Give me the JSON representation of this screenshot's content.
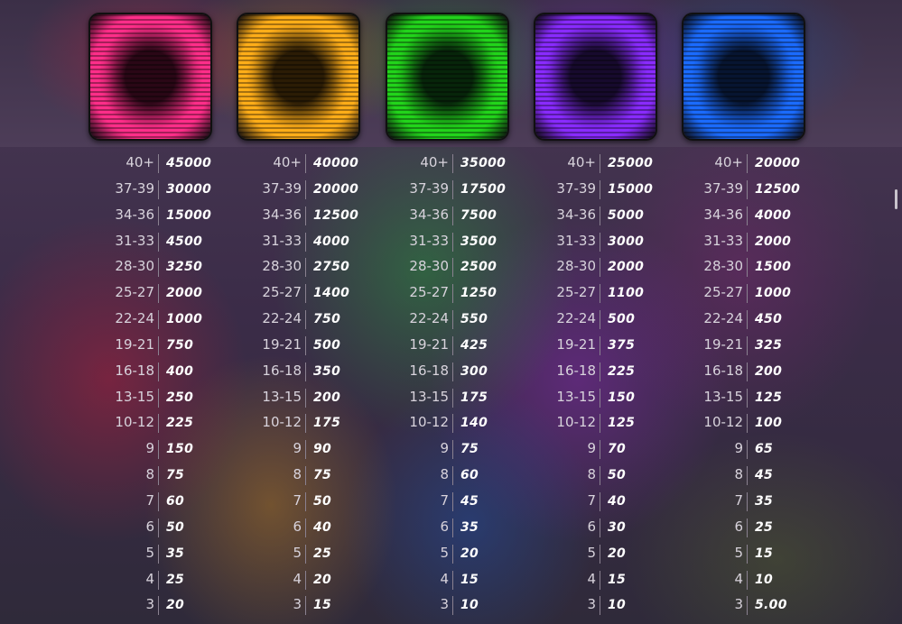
{
  "symbols": [
    {
      "name": "pink",
      "color": "#ff2f8a",
      "core": "#2a0716"
    },
    {
      "name": "orange",
      "color": "#ffae1a",
      "core": "#2b1c05"
    },
    {
      "name": "green",
      "color": "#23d51c",
      "core": "#07250a"
    },
    {
      "name": "purple",
      "color": "#8a2cff",
      "core": "#170a2d"
    },
    {
      "name": "blue",
      "color": "#1c6cff",
      "core": "#071531"
    }
  ],
  "ranges": [
    "40+",
    "37-39",
    "34-36",
    "31-33",
    "28-30",
    "25-27",
    "22-24",
    "19-21",
    "16-18",
    "13-15",
    "10-12",
    "9",
    "8",
    "7",
    "6",
    "5",
    "4",
    "3"
  ],
  "paytable": [
    {
      "symbol": "pink",
      "payouts": [
        "45000",
        "30000",
        "15000",
        "4500",
        "3250",
        "2000",
        "1000",
        "750",
        "400",
        "250",
        "225",
        "150",
        "75",
        "60",
        "50",
        "35",
        "25",
        "20"
      ]
    },
    {
      "symbol": "orange",
      "payouts": [
        "40000",
        "20000",
        "12500",
        "4000",
        "2750",
        "1400",
        "750",
        "500",
        "350",
        "200",
        "175",
        "90",
        "75",
        "50",
        "40",
        "25",
        "20",
        "15"
      ]
    },
    {
      "symbol": "green",
      "payouts": [
        "35000",
        "17500",
        "7500",
        "3500",
        "2500",
        "1250",
        "550",
        "425",
        "300",
        "175",
        "140",
        "75",
        "60",
        "45",
        "35",
        "20",
        "15",
        "10"
      ]
    },
    {
      "symbol": "purple",
      "payouts": [
        "25000",
        "15000",
        "5000",
        "3000",
        "2000",
        "1100",
        "500",
        "375",
        "225",
        "150",
        "125",
        "70",
        "50",
        "40",
        "30",
        "20",
        "15",
        "10"
      ]
    },
    {
      "symbol": "blue",
      "payouts": [
        "20000",
        "12500",
        "4000",
        "2000",
        "1500",
        "1000",
        "450",
        "325",
        "200",
        "125",
        "100",
        "65",
        "45",
        "35",
        "25",
        "15",
        "10",
        "5.00"
      ]
    }
  ]
}
